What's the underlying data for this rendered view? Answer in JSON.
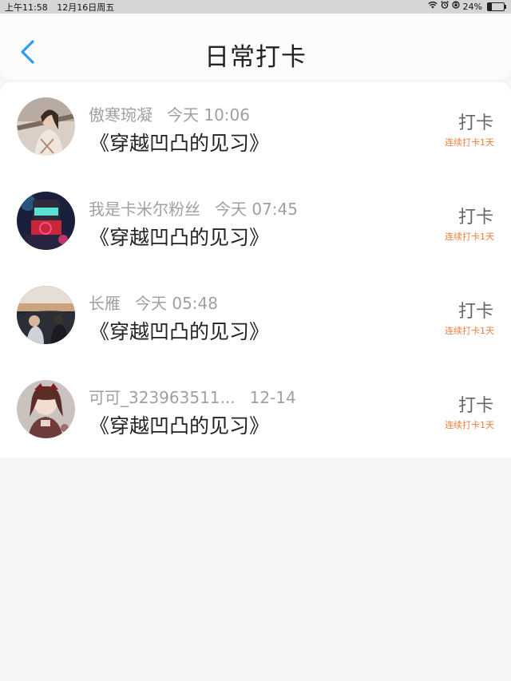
{
  "status_bar": {
    "time": "上午11:58",
    "date": "12月16日周五",
    "wifi_icon": "wifi-icon",
    "alarm_icon": "alarm-icon",
    "rotation_lock_icon": "rotation-lock-icon",
    "battery_percent": "24%",
    "battery_level": 0.24
  },
  "nav": {
    "back_icon": "chevron-left-icon",
    "title": "日常打卡",
    "accent_color": "#2f9bf0"
  },
  "checkins": [
    {
      "username": "傲寒琬凝",
      "time": "今天 10:06",
      "book": "《穿越凹凸的见习》",
      "action": "打卡",
      "streak": "连续打卡1天"
    },
    {
      "username": "我是卡米尔粉丝",
      "time": "今天 07:45",
      "book": "《穿越凹凸的见习》",
      "action": "打卡",
      "streak": "连续打卡1天"
    },
    {
      "username": "长雁",
      "time": "今天 05:48",
      "book": "《穿越凹凸的见习》",
      "action": "打卡",
      "streak": "连续打卡1天"
    },
    {
      "username": "可可_323963511...",
      "time": "12-14",
      "book": "《穿越凹凸的见习》",
      "action": "打卡",
      "streak": "连续打卡1天"
    }
  ],
  "colors": {
    "streak": "#f17d3a",
    "page_bg": "#f6f5f6"
  }
}
